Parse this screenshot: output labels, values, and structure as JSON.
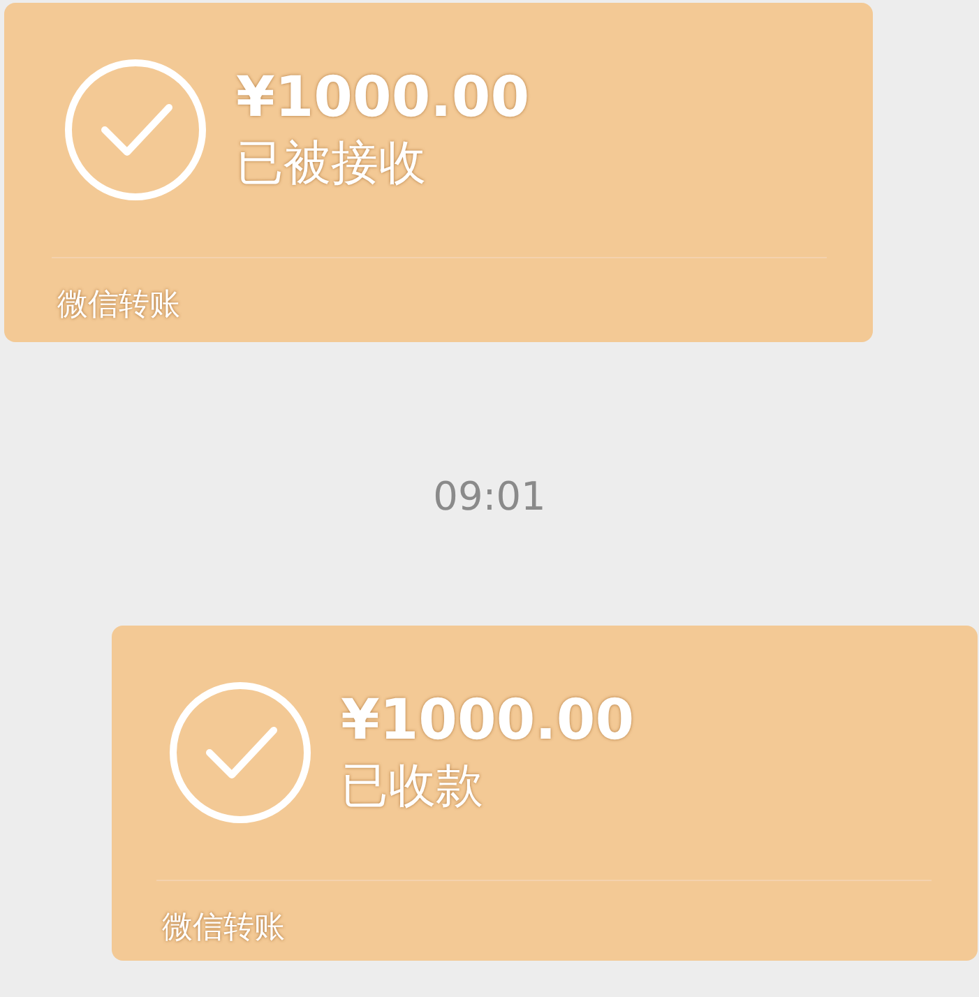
{
  "messages": [
    {
      "kind": "transfer",
      "outgoing": false,
      "amount": "¥1000.00",
      "status": "已被接收",
      "footer": "微信转账"
    },
    {
      "kind": "time",
      "text": "09:01"
    },
    {
      "kind": "transfer",
      "outgoing": true,
      "amount": "¥1000.00",
      "status": "已收款",
      "footer": "微信转账"
    }
  ]
}
